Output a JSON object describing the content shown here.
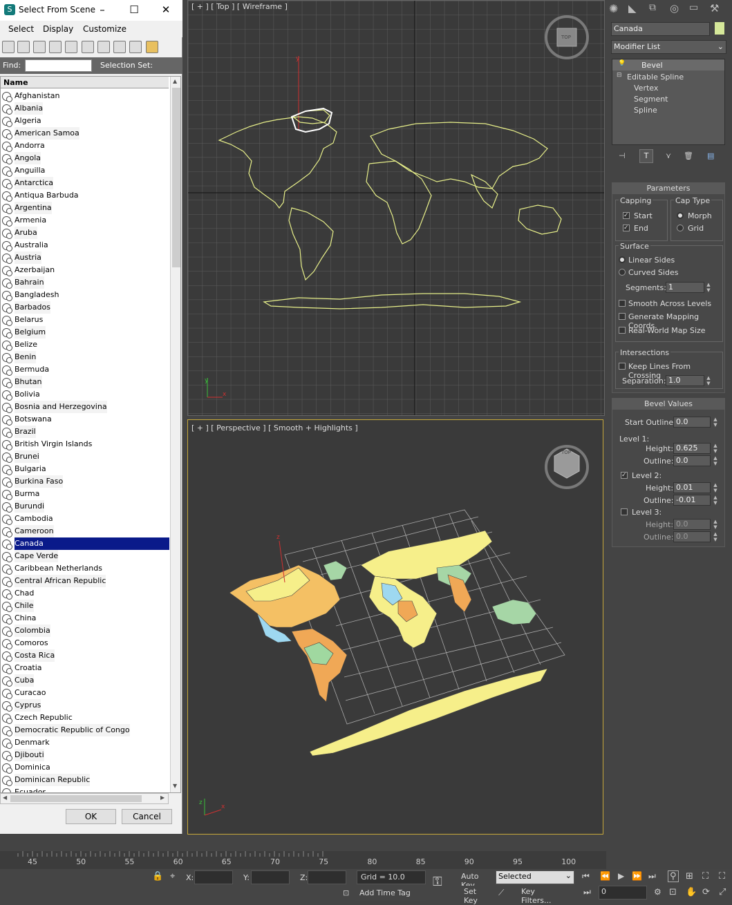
{
  "dialog": {
    "title": "Select From Scene",
    "menu": [
      "Select",
      "Display",
      "Customize"
    ],
    "find_label": "Find:",
    "find_value": "",
    "selection_set_label": "Selection Set:",
    "column_name": "Name",
    "items": [
      "Afghanistan",
      "Albania",
      "Algeria",
      "American Samoa",
      "Andorra",
      "Angola",
      "Anguilla",
      "Antarctica",
      "Antiqua Barbuda",
      "Argentina",
      "Armenia",
      "Aruba",
      "Australia",
      "Austria",
      "Azerbaijan",
      "Bahrain",
      "Bangladesh",
      "Barbados",
      "Belarus",
      "Belgium",
      "Belize",
      "Benin",
      "Bermuda",
      "Bhutan",
      "Bolivia",
      "Bosnia and Herzegovina",
      "Botswana",
      "Brazil",
      "British Virgin Islands",
      "Brunei",
      "Bulgaria",
      "Burkina Faso",
      "Burma",
      "Burundi",
      "Cambodia",
      "Cameroon",
      "Canada",
      "Cape Verde",
      "Caribbean Netherlands",
      "Central African Republic",
      "Chad",
      "Chile",
      "China",
      "Colombia",
      "Comoros",
      "Costa Rica",
      "Croatia",
      "Cuba",
      "Curacao",
      "Cyprus",
      "Czech Republic",
      "Democratic Republic of Congo",
      "Denmark",
      "Djibouti",
      "Dominica",
      "Dominican Republic",
      "Ecuador"
    ],
    "selected_item": "Canada",
    "ok_label": "OK",
    "cancel_label": "Cancel"
  },
  "viewports": {
    "top_label": "[ + ] [ Top ] [ Wireframe ]",
    "top_cube": "TOP",
    "persp_label": "[ + ] [ Perspective ] [ Smooth + Highlights ]",
    "persp_cube": "TOP"
  },
  "command_panel": {
    "object_name": "Canada",
    "object_color": "#d6e89a",
    "modifier_list": "Modifier List",
    "stack": [
      {
        "label": "Bevel",
        "level": 0
      },
      {
        "label": "Editable Spline",
        "level": 0
      },
      {
        "label": "Vertex",
        "level": 1
      },
      {
        "label": "Segment",
        "level": 1
      },
      {
        "label": "Spline",
        "level": 1
      }
    ],
    "parameters": {
      "title": "Parameters",
      "capping_label": "Capping",
      "start_label": "Start",
      "end_label": "End",
      "cap_type_label": "Cap Type",
      "morph_label": "Morph",
      "grid_label": "Grid",
      "surface_label": "Surface",
      "linear_sides_label": "Linear Sides",
      "curved_sides_label": "Curved Sides",
      "segments_label": "Segments:",
      "segments_value": "1",
      "smooth_label": "Smooth Across Levels",
      "mapping_label": "Generate Mapping Coords.",
      "realworld_label": "Real-World Map Size",
      "intersections_label": "Intersections",
      "keep_lines_label": "Keep Lines From Crossing",
      "separation_label": "Separation:",
      "separation_value": "1.0"
    },
    "bevel_values": {
      "title": "Bevel Values",
      "start_outline_label": "Start Outline:",
      "start_outline_value": "0.0",
      "level1_label": "Level 1:",
      "height_label": "Height:",
      "outline_label": "Outline:",
      "level1_height": "0.625",
      "level1_outline": "0.0",
      "level2_label": "Level 2:",
      "level2_height": "0.01",
      "level2_outline": "-0.01",
      "level3_label": "Level 3:",
      "level3_height": "0.0",
      "level3_outline": "0.0"
    }
  },
  "timeline": {
    "ticks": [
      "45",
      "50",
      "55",
      "60",
      "65",
      "70",
      "75",
      "80",
      "85",
      "90",
      "95",
      "100"
    ]
  },
  "status": {
    "x_label": "X:",
    "y_label": "Y:",
    "z_label": "Z:",
    "grid_text": "Grid = 10.0",
    "add_time_tag": "Add Time Tag",
    "auto_key": "Auto Key",
    "set_key": "Set Key",
    "key_mode": "Selected",
    "key_filters": "Key Filters...",
    "frame_value": "0"
  }
}
